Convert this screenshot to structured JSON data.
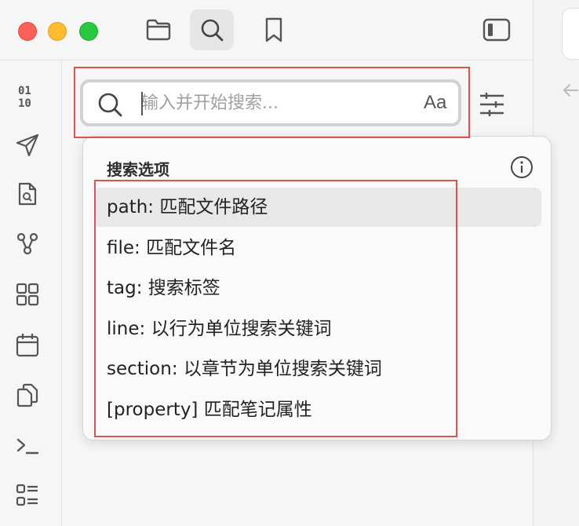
{
  "window": {
    "traffic_lights": [
      "close",
      "minimize",
      "zoom"
    ],
    "toolbar_icons": [
      "folder-icon",
      "search-icon",
      "bookmark-icon",
      "sidebar-toggle-icon"
    ]
  },
  "ribbon": {
    "icons": [
      "binary-icon",
      "send-icon",
      "file-search-icon",
      "graph-icon",
      "grid-icon",
      "calendar-icon",
      "copy-icon",
      "terminal-icon",
      "list-icon"
    ]
  },
  "search": {
    "placeholder": "输入并开始搜索...",
    "value": "",
    "case_toggle_label": "Aa"
  },
  "dropdown": {
    "title": "搜索选项",
    "options": [
      {
        "keyword": "path:",
        "desc": " 匹配文件路径"
      },
      {
        "keyword": "file:",
        "desc": " 匹配文件名"
      },
      {
        "keyword": "tag:",
        "desc": " 搜索标签"
      },
      {
        "keyword": "line:",
        "desc": " 以行为单位搜索关键词"
      },
      {
        "keyword": "section:",
        "desc": " 以章节为单位搜索关键词"
      },
      {
        "keyword": "[property]",
        "desc": " 匹配笔记属性"
      }
    ]
  },
  "colors": {
    "highlight_border": "#e05252",
    "hover_row": "#e8e8e8",
    "background": "#f6f6f6"
  }
}
